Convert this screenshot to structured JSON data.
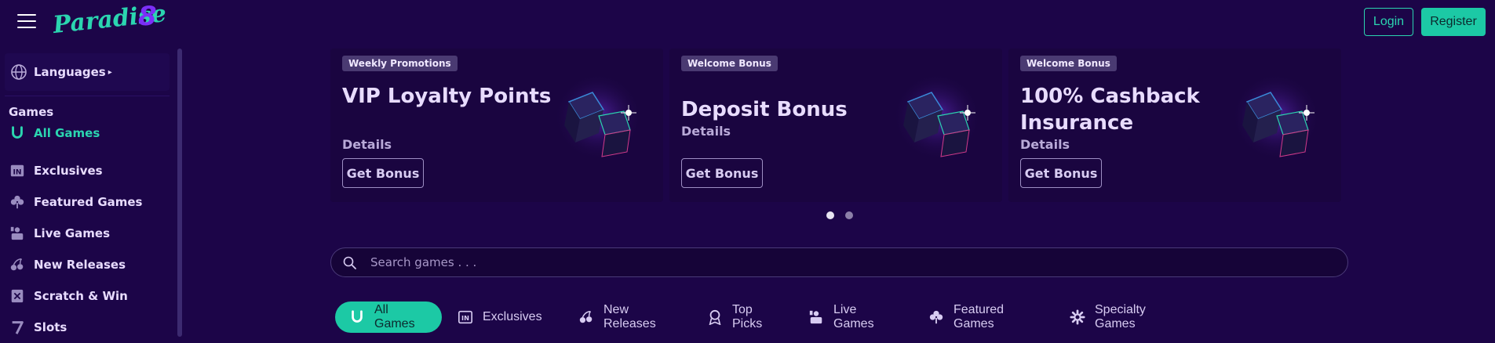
{
  "brand": {
    "logo_text": "Paradise8",
    "accent": "#1cc9a5",
    "background": "#1c0548"
  },
  "header": {
    "login_label": "Login",
    "register_label": "Register"
  },
  "sidebar": {
    "languages_label": "Languages",
    "games_heading": "Games",
    "items": [
      {
        "label": "All Games",
        "icon": "horseshoe-icon",
        "active": true
      },
      {
        "label": "Exclusives",
        "icon": "in-logo-icon",
        "active": false
      },
      {
        "label": "Featured Games",
        "icon": "clover-icon",
        "active": false
      },
      {
        "label": "Live Games",
        "icon": "dealer-icon",
        "active": false
      },
      {
        "label": "New Releases",
        "icon": "cherries-icon",
        "active": false
      },
      {
        "label": "Scratch & Win",
        "icon": "scratch-card-icon",
        "active": false
      },
      {
        "label": "Slots",
        "icon": "seven-icon",
        "active": false
      }
    ]
  },
  "promos": [
    {
      "badge": "Weekly Promotions",
      "title": "VIP Loyalty Points",
      "details": "Details",
      "button": "Get Bonus"
    },
    {
      "badge": "Welcome Bonus",
      "title": "Deposit Bonus",
      "details": "Details",
      "button": "Get Bonus"
    },
    {
      "badge": "Welcome Bonus",
      "title": "100% Cashback Insurance",
      "details": "Details",
      "button": "Get Bonus"
    }
  ],
  "carousel": {
    "pages": 2,
    "current": 1
  },
  "search": {
    "placeholder": "Search games . . .",
    "value": ""
  },
  "tabs": [
    {
      "label": "All Games",
      "icon": "horseshoe-icon",
      "active": true
    },
    {
      "label": "Exclusives",
      "icon": "in-logo-icon",
      "active": false
    },
    {
      "label": "New Releases",
      "icon": "cherries-icon",
      "active": false
    },
    {
      "label": "Top Picks",
      "icon": "award-icon",
      "active": false
    },
    {
      "label": "Live Games",
      "icon": "dealer-icon",
      "active": false
    },
    {
      "label": "Featured Games",
      "icon": "clover-icon",
      "active": false
    },
    {
      "label": "Specialty Games",
      "icon": "gear-icon",
      "active": false
    }
  ]
}
